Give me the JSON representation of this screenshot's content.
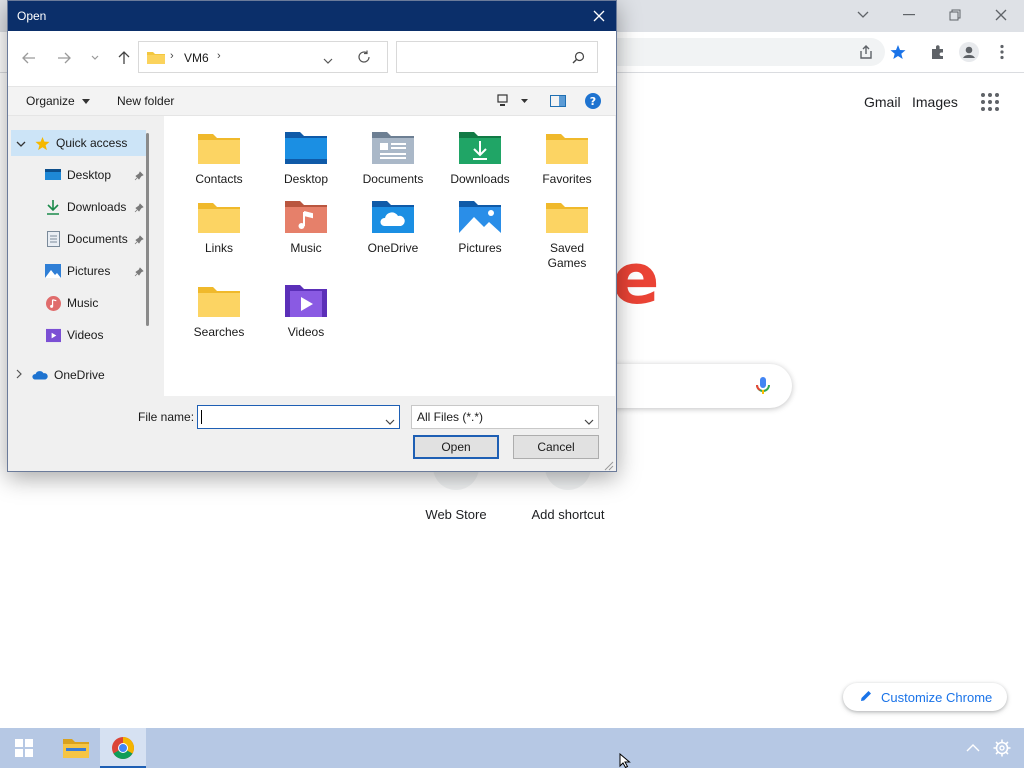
{
  "chrome": {
    "top_links": [
      "Gmail",
      "Images"
    ],
    "logo_fragment": "e",
    "shortcuts": [
      "Web Store",
      "Add shortcut"
    ],
    "customize_label": "Customize Chrome",
    "accent_color": "#1a73e8"
  },
  "dialog": {
    "title": "Open",
    "breadcrumb": [
      "VM6"
    ],
    "search_placeholder": "",
    "commands": {
      "organize": "Organize",
      "new_folder": "New folder"
    },
    "nav_items": [
      {
        "label": "Quick access",
        "icon": "star-icon"
      },
      {
        "label": "Desktop",
        "icon": "desktop-icon"
      },
      {
        "label": "Downloads",
        "icon": "download-icon"
      },
      {
        "label": "Documents",
        "icon": "documents-icon"
      },
      {
        "label": "Pictures",
        "icon": "pictures-icon"
      },
      {
        "label": "Music",
        "icon": "music-icon"
      },
      {
        "label": "Videos",
        "icon": "videos-icon"
      },
      {
        "label": "OneDrive",
        "icon": "onedrive-icon"
      }
    ],
    "folders": [
      {
        "label": "Contacts",
        "icon": "folder-icon"
      },
      {
        "label": "Desktop",
        "icon": "desktop-folder-icon"
      },
      {
        "label": "Documents",
        "icon": "documents-folder-icon"
      },
      {
        "label": "Downloads",
        "icon": "downloads-folder-icon"
      },
      {
        "label": "Favorites",
        "icon": "folder-icon"
      },
      {
        "label": "Links",
        "icon": "folder-icon"
      },
      {
        "label": "Music",
        "icon": "music-folder-icon"
      },
      {
        "label": "OneDrive",
        "icon": "onedrive-folder-icon"
      },
      {
        "label": "Pictures",
        "icon": "pictures-folder-icon"
      },
      {
        "label": "Saved Games",
        "icon": "folder-icon"
      },
      {
        "label": "Searches",
        "icon": "folder-icon"
      },
      {
        "label": "Videos",
        "icon": "videos-folder-icon"
      }
    ],
    "file_name_label": "File name:",
    "file_name_value": "",
    "file_type": "All Files (*.*)",
    "open_button": "Open",
    "cancel_button": "Cancel"
  },
  "taskbar": {
    "apps": [
      "start-icon",
      "file-explorer-icon",
      "chrome-icon"
    ]
  }
}
